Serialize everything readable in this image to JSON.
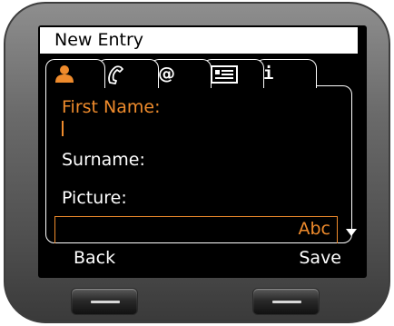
{
  "screen": {
    "title": "New Entry",
    "tabs": [
      {
        "icon": "person-icon",
        "active": true
      },
      {
        "icon": "phone-handset-icon",
        "active": false
      },
      {
        "icon": "at-sign-icon",
        "label": "@",
        "active": false
      },
      {
        "icon": "vcard-icon",
        "active": false
      },
      {
        "icon": "info-icon",
        "label": "i",
        "active": false
      }
    ],
    "fields": {
      "first_name_label": "First Name:",
      "surname_label": "Surname:",
      "picture_label": "Picture:"
    },
    "input_mode": "Abc",
    "softkeys": {
      "left": "Back",
      "right": "Save"
    }
  },
  "colors": {
    "accent": "#ef8b2c",
    "screen_bg": "#000000",
    "title_bg": "#ffffff"
  }
}
